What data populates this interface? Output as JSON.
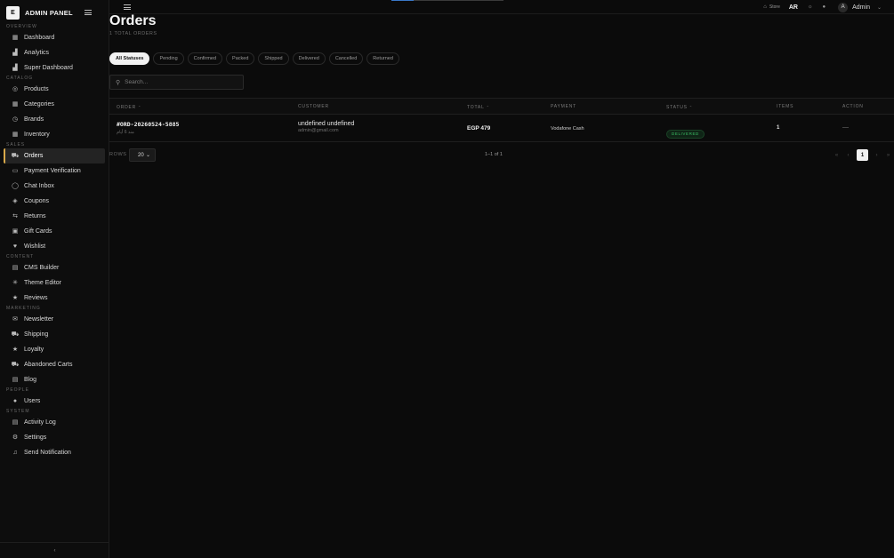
{
  "sidebar": {
    "brand_logo": "E",
    "brand_name": "ADMIN PANEL",
    "sections": [
      {
        "label": "OVERVIEW",
        "items": [
          {
            "label": "Dashboard",
            "icon": "grid-icon"
          },
          {
            "label": "Analytics",
            "icon": "bar-chart-icon"
          },
          {
            "label": "Super Dashboard",
            "icon": "bar-chart-icon"
          }
        ]
      },
      {
        "label": "CATALOG",
        "items": [
          {
            "label": "Products",
            "icon": "package-icon"
          },
          {
            "label": "Categories",
            "icon": "grid-icon"
          },
          {
            "label": "Brands",
            "icon": "clock-icon"
          },
          {
            "label": "Inventory",
            "icon": "grid-icon"
          }
        ]
      },
      {
        "label": "SALES",
        "items": [
          {
            "label": "Orders",
            "icon": "cart-icon"
          },
          {
            "label": "Payment Verification",
            "icon": "card-icon"
          },
          {
            "label": "Chat Inbox",
            "icon": "chat-icon"
          },
          {
            "label": "Coupons",
            "icon": "tag-icon"
          },
          {
            "label": "Returns",
            "icon": "return-icon"
          },
          {
            "label": "Gift Cards",
            "icon": "gift-icon"
          },
          {
            "label": "Wishlist",
            "icon": "heart-icon"
          }
        ]
      },
      {
        "label": "CONTENT",
        "items": [
          {
            "label": "CMS Builder",
            "icon": "layout-icon"
          },
          {
            "label": "Theme Editor",
            "icon": "sun-icon"
          },
          {
            "label": "Reviews",
            "icon": "star-icon"
          }
        ]
      },
      {
        "label": "MARKETING",
        "items": [
          {
            "label": "Newsletter",
            "icon": "mail-icon"
          },
          {
            "label": "Shipping",
            "icon": "truck-icon"
          },
          {
            "label": "Loyalty",
            "icon": "star-icon"
          },
          {
            "label": "Abandoned Carts",
            "icon": "cart-icon"
          },
          {
            "label": "Blog",
            "icon": "document-icon"
          }
        ]
      },
      {
        "label": "PEOPLE",
        "items": [
          {
            "label": "Users",
            "icon": "user-icon"
          }
        ]
      },
      {
        "label": "SYSTEM",
        "items": [
          {
            "label": "Activity Log",
            "icon": "document-icon"
          },
          {
            "label": "Settings",
            "icon": "gear-icon"
          },
          {
            "label": "Send Notification",
            "icon": "bell-icon"
          }
        ]
      }
    ],
    "active_item": "Orders",
    "collapse_label": "‹"
  },
  "topbar": {
    "store_label": "Store",
    "lang_label": "AR",
    "user_initial": "A",
    "user_name": "Admin",
    "loading_progress": 0.2
  },
  "page": {
    "title": "Orders",
    "subtitle": "1 TOTAL ORDERS"
  },
  "filters": [
    "All Statuses",
    "Pending",
    "Confirmed",
    "Packed",
    "Shipped",
    "Delivered",
    "Cancelled",
    "Returned"
  ],
  "active_filter": "All Statuses",
  "search": {
    "placeholder": "Search..."
  },
  "table": {
    "columns": [
      "ORDER",
      "CUSTOMER",
      "TOTAL",
      "PAYMENT",
      "STATUS",
      "ITEMS",
      "ACTION"
    ],
    "sortable": [
      "ORDER",
      "TOTAL",
      "STATUS"
    ],
    "rows": [
      {
        "order_id": "#ORD-20260524-5885",
        "date": "منذ 6 أيام",
        "customer_name": "undefined undefined",
        "customer_email": "admin@gmail.com",
        "total": "EGP 479",
        "payment": "Vodafone Cash",
        "status": "DELIVERED",
        "items": "1",
        "action": "—"
      }
    ]
  },
  "pagination": {
    "rows_label": "ROWS",
    "rows_value": "20",
    "page_info": "1–1 of 1",
    "current_page": "1"
  },
  "colors": {
    "accent": "#d8a94a",
    "status_delivered": "#3bbf64",
    "background": "#0b0b0b"
  }
}
